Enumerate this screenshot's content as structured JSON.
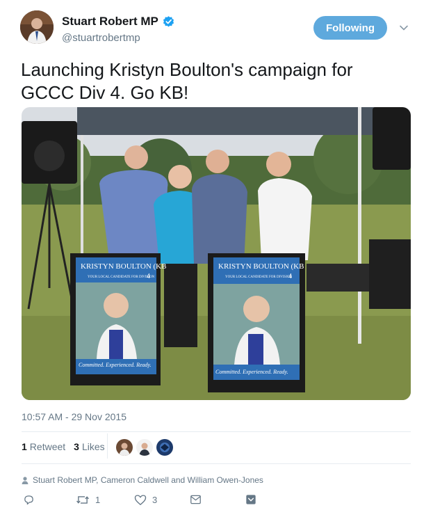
{
  "user": {
    "display_name": "Stuart Robert MP",
    "handle": "@stuartrobertmp",
    "verified": true,
    "follow_label": "Following"
  },
  "tweet": {
    "text": "Launching Kristyn Boulton's campaign for GCCC Div 4. Go KB!",
    "timestamp": "10:57 AM - 29 Nov 2015"
  },
  "photo": {
    "signs": [
      {
        "name": "KRISTYN BOULTON (KB",
        "subtitle": "YOUR LOCAL CANDIDATE FOR DIVISION",
        "division": "4",
        "slogan": "Committed. Experienced. Ready."
      },
      {
        "name": "KRISTYN BOULTON (KB",
        "subtitle": "YOUR LOCAL CANDIDATE FOR DIVISION",
        "division": "4",
        "slogan": "Committed. Experienced. Ready."
      }
    ]
  },
  "stats": {
    "retweets_count": "1",
    "retweets_label": "Retweet",
    "likes_count": "3",
    "likes_label": "Likes"
  },
  "context": {
    "text": "Stuart Robert MP, Cameron Caldwell and William Owen-Jones"
  },
  "actions": {
    "reply_icon": "reply-icon",
    "retweet_icon": "retweet-icon",
    "retweet_count": "1",
    "like_icon": "heart-icon",
    "like_count": "3",
    "dm_icon": "envelope-icon",
    "more_icon": "chevron-down-icon"
  },
  "colors": {
    "accent": "#1da1f2",
    "follow_bg": "#5ea9dd",
    "muted": "#657786",
    "text": "#14171a"
  }
}
